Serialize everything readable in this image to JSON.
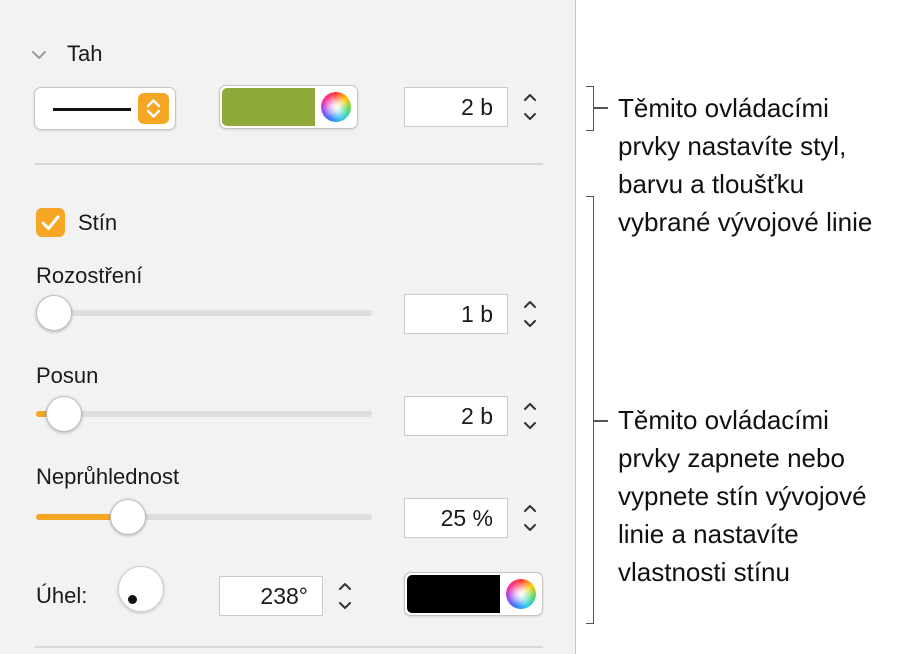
{
  "stroke": {
    "title": "Tah",
    "color": "#8faa3a",
    "width_value": "2 b"
  },
  "shadow": {
    "title": "Stín",
    "enabled": true,
    "blur": {
      "label": "Rozostření",
      "value": "1 b",
      "level": 0.02
    },
    "offset": {
      "label": "Posun",
      "value": "2 b",
      "level": 0.06
    },
    "opacity": {
      "label": "Neprůhlednost",
      "value": "25 %",
      "level": 0.25
    },
    "angle": {
      "label": "Úhel:",
      "value": "238°"
    },
    "color": "#000000"
  },
  "annotations": {
    "top": [
      "Těmito ovládacími",
      "prvky nastavíte styl,",
      "barvu a tloušťku",
      "vybrané vývojové linie"
    ],
    "bottom": [
      "Těmito ovládacími",
      "prvky zapnete nebo",
      "vypnete stín vývojové",
      "linie a nastavíte",
      "vlastnosti stínu"
    ]
  },
  "colors": {
    "accent": "#f5a623",
    "checkbox": "#f5a623"
  },
  "icons": [
    "chevron-down-icon",
    "up-down-arrows-icon",
    "color-wheel-icon",
    "checkmark-icon",
    "stepper-up-icon",
    "stepper-down-icon"
  ]
}
